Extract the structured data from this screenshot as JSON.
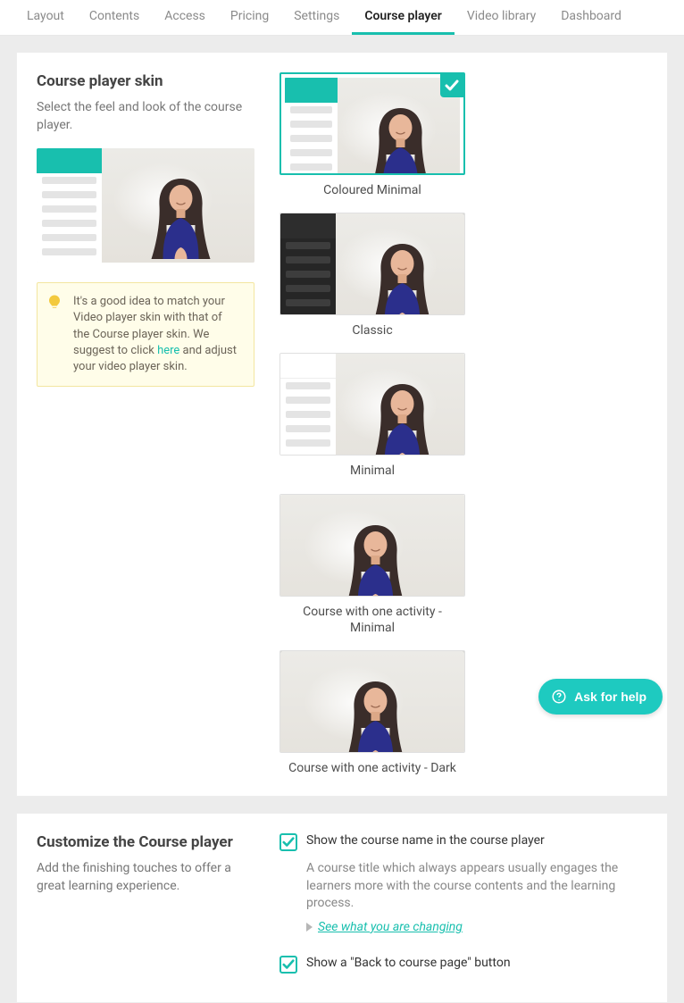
{
  "nav": {
    "tabs": [
      {
        "label": "Layout"
      },
      {
        "label": "Contents"
      },
      {
        "label": "Access"
      },
      {
        "label": "Pricing"
      },
      {
        "label": "Settings"
      },
      {
        "label": "Course player",
        "active": true
      },
      {
        "label": "Video library"
      },
      {
        "label": "Dashboard"
      }
    ]
  },
  "skin_section": {
    "title": "Course player skin",
    "subtitle": "Select the feel and look of the course player.",
    "hint_text_1": "It's a good idea to match your Video player skin with that of the Course player skin. We suggest to click ",
    "hint_link": "here",
    "hint_text_2": " and adjust your video player skin."
  },
  "skins": [
    {
      "id": "coloured-minimal",
      "label": "Coloured Minimal",
      "style": "coloured",
      "selected": true
    },
    {
      "id": "classic",
      "label": "Classic",
      "style": "classic",
      "selected": false
    },
    {
      "id": "minimal",
      "label": "Minimal",
      "style": "minimal",
      "selected": false
    },
    {
      "id": "one-activity-min",
      "label": "Course with one activity - Minimal",
      "style": "only",
      "selected": false
    },
    {
      "id": "one-activity-dark",
      "label": "Course with one activity - Dark",
      "style": "only-dark",
      "selected": false
    }
  ],
  "customize": {
    "title": "Customize the Course player",
    "subtitle": "Add the finishing touches to offer a great learning experience.",
    "opt1_label": "Show the course name in the course player",
    "opt1_desc": "A course title which always appears usually engages the learners more with the course contents and the learning process.",
    "opt1_link": "See what you are changing",
    "opt2_label": "Show a \"Back to course page\" button"
  },
  "help": {
    "label": "Ask for help"
  }
}
